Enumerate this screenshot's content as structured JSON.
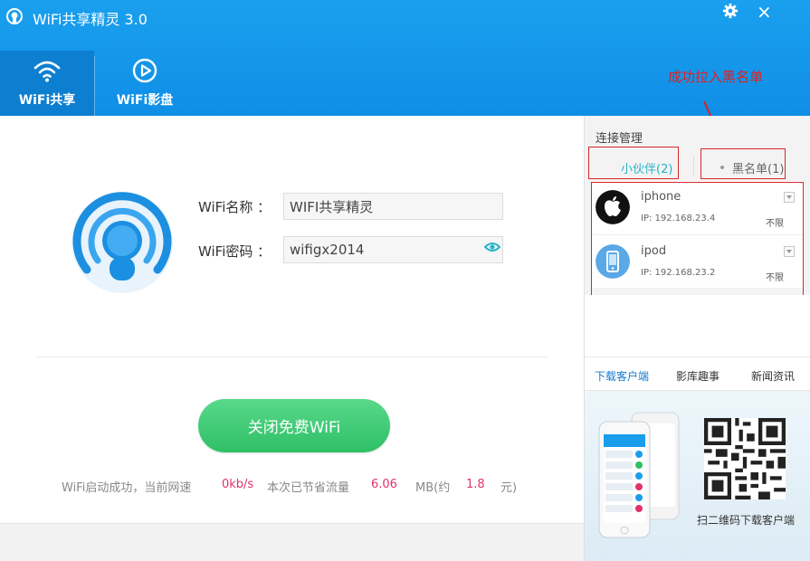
{
  "header": {
    "app_title": "WiFi共享精灵 3.0",
    "tabs": [
      {
        "label": "WiFi共享",
        "icon": "wifi-icon",
        "active": true
      },
      {
        "label": "WiFi影盘",
        "icon": "play-circle-icon",
        "active": false
      }
    ],
    "settings_icon": "gear-icon",
    "close_glyph": "×"
  },
  "annotation": {
    "text": "成功拉入黑名单",
    "color": "#e02020"
  },
  "main": {
    "fields": [
      {
        "label": "WiFi名称 ：",
        "value": "WIFI共享精灵"
      },
      {
        "label": "WiFi密码 ：",
        "value": "wifigx2014"
      }
    ],
    "button_label": "关闭免费WiFi",
    "status": {
      "prefix": "WiFi启动成功，当前网速",
      "speed": "0kb/s",
      "saved_label": "本次已节省流量",
      "saved_value": "6.06",
      "unit_mb": "MB(约",
      "money": "1.8",
      "unit_yuan": "元)"
    }
  },
  "right_panel": {
    "title": "连接管理",
    "tabs": [
      {
        "label": "小伙伴(2)",
        "active": true
      },
      {
        "label": "黑名单(1)",
        "active": false
      }
    ],
    "devices": [
      {
        "name": "iphone",
        "ip": "IP: 192.168.23.4",
        "limit": "不限",
        "icon": "apple-icon"
      },
      {
        "name": "ipod",
        "ip": "IP: 192.168.23.2",
        "limit": "不限",
        "icon": "ipod-icon"
      }
    ],
    "bottom_tabs": [
      {
        "label": "下载客户端",
        "active": true
      },
      {
        "label": "影库趣事",
        "active": false
      },
      {
        "label": "新闻资讯",
        "active": false
      }
    ],
    "qr_caption": "扫二维码下载客户端"
  },
  "colors": {
    "header_blue": "#1aa0ee",
    "accent_green": "#2fbf66",
    "pink": "#e2326a",
    "link_blue": "#1479d0",
    "red_box": "#d8262a"
  }
}
